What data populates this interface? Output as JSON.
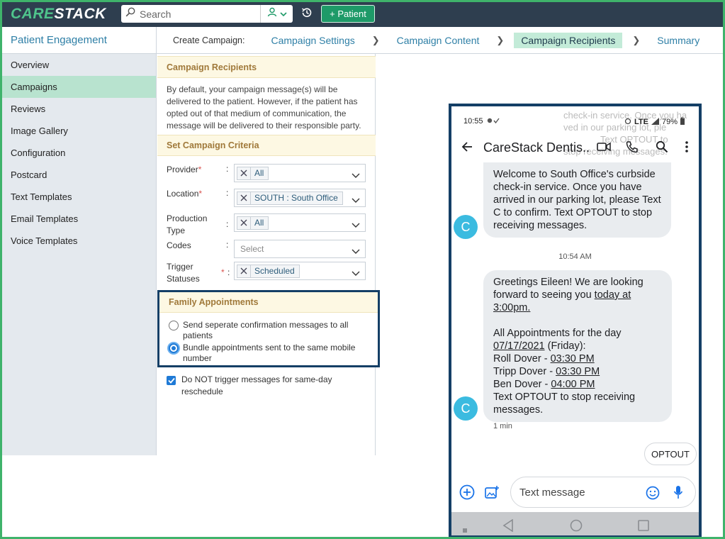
{
  "app": {
    "logo_part1": "CARE",
    "logo_part2": "STACK"
  },
  "topbar": {
    "search_placeholder": "Search",
    "add_patient_label": "+ Patient",
    "colors": {
      "bar": "#2e3e4f",
      "accent": "#1e9a68"
    }
  },
  "module_title": "Patient Engagement",
  "breadcrumb": {
    "lead": "Create Campaign:",
    "steps": [
      "Campaign Settings",
      "Campaign Content",
      "Campaign Recipients",
      "Summary"
    ],
    "active": "Campaign Recipients"
  },
  "sidebar": {
    "items": [
      "Overview",
      "Campaigns",
      "Reviews",
      "Image Gallery",
      "Configuration",
      "Postcard",
      "Text Templates",
      "Email Templates",
      "Voice Templates"
    ],
    "active": "Campaigns"
  },
  "recipients": {
    "heading": "Campaign Recipients",
    "intro": "By default, your campaign message(s) will be delivered to the patient. However, if the patient has opted out of that medium of communication, the message will be delivered to their responsible party."
  },
  "criteria": {
    "heading": "Set Campaign Criteria",
    "provider": {
      "label": "Provider",
      "value": "All"
    },
    "location": {
      "label": "Location",
      "value": "SOUTH : South Office"
    },
    "production_type": {
      "label_line1": "Production",
      "label_line2": "Type",
      "value": "All"
    },
    "codes": {
      "label": "Codes",
      "placeholder": "Select"
    },
    "trigger_statuses": {
      "label_line1": "Trigger",
      "label_line2": "Statuses",
      "value": "Scheduled"
    },
    "required_mark": "*",
    "colon": ":"
  },
  "family": {
    "heading": "Family Appointments",
    "option1": "Send seperate confirmation messages to all patients",
    "option2": "Bundle appointments sent to the same mobile number",
    "selected": "option2"
  },
  "same_day": {
    "label": "Do NOT trigger messages for same-day reschedule",
    "checked": true
  },
  "phone": {
    "status_time": "10:55",
    "status_network": "LTE",
    "status_battery": "79%",
    "contact_title": "CareStack Dentis...",
    "ghost_line1": "check-in service. Once you ha",
    "ghost_line2": "ved in our parking lot, ple",
    "ghost_line3": "Text OPTOUT to",
    "ghost_line4": "stop receiving messages.",
    "msg1": "Welcome to South Office's curbside check-in service. Once you have arrived in our parking lot, please Text C to confirm. Text OPTOUT to stop receiving messages.",
    "divider_time": "10:54 AM",
    "msg2": {
      "greeting": "Greetings Eileen!  We are looking forward to seeing you",
      "when": "today at 3:00pm.",
      "all_appts": "All Appointments for the day",
      "date": "07/17/2021",
      "day": "(Friday):",
      "appts": [
        {
          "name": "Roll Dover - ",
          "time": "03:30 PM"
        },
        {
          "name": "Tripp Dover - ",
          "time": "03:30 PM"
        },
        {
          "name": "Ben Dover - ",
          "time": "04:00 PM"
        }
      ],
      "footer": "Text OPTOUT to stop receiving messages."
    },
    "avatar_letter": "C",
    "ago": "1 min",
    "reply": "OPTOUT",
    "compose_placeholder": "Text message"
  }
}
